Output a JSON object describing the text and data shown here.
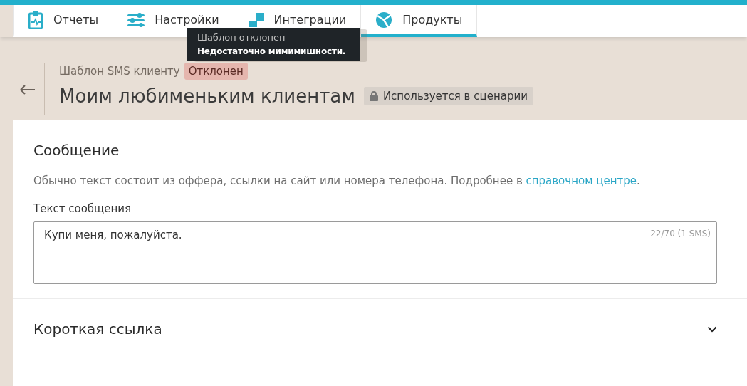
{
  "nav": {
    "tabs": [
      {
        "label": "Отчеты",
        "selected": false
      },
      {
        "label": "Настройки",
        "selected": false
      },
      {
        "label": "Интеграции",
        "selected": false
      },
      {
        "label": "Продукты",
        "selected": true
      }
    ]
  },
  "tooltip": {
    "title": "Шаблон отклонен",
    "text": "Недостаточно мимимишности."
  },
  "header": {
    "breadcrumb": "Шаблон SMS клиенту",
    "status": "Отклонен",
    "title": "Моим любименьким клиентам",
    "lock_badge": "Используется в сценарии"
  },
  "message": {
    "heading": "Сообщение",
    "description": "Обычно текст состоит из оффера, ссылки на сайт или номера телефона. Подробнее в ",
    "link": "справочном центре",
    "description_end": ".",
    "field_label": "Текст сообщения",
    "value": "Купи меня, пожалуйста.",
    "counter": "22/70 (1 SMS)"
  },
  "short_link": {
    "heading": "Короткая ссылка",
    "expanded": false
  }
}
